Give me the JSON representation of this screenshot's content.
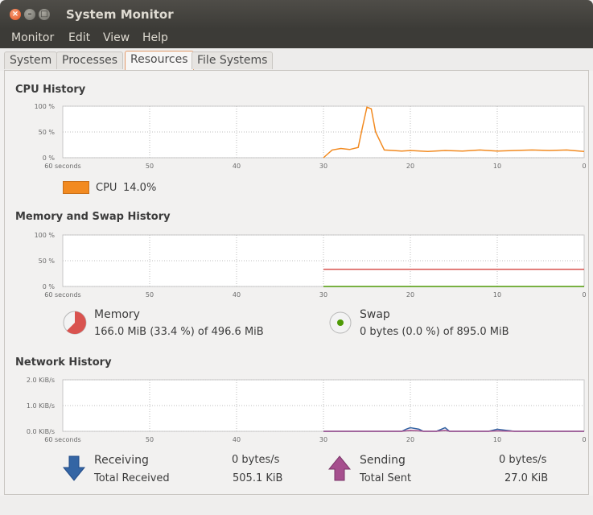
{
  "window": {
    "title": "System Monitor",
    "buttons": {
      "close": "×",
      "minimize": "–",
      "maximize": "□"
    }
  },
  "menu": [
    "Monitor",
    "Edit",
    "View",
    "Help"
  ],
  "tabs": [
    "System",
    "Processes",
    "Resources",
    "File Systems"
  ],
  "active_tab": "Resources",
  "colors": {
    "cpu": "#f28a20",
    "memory": "#d9534f",
    "swap": "#4e9a06",
    "receiving": "#3465a4",
    "sending": "#a64f8e"
  },
  "x_tick_labels": [
    "60 seconds",
    "50",
    "40",
    "30",
    "20",
    "10",
    "0"
  ],
  "cpu": {
    "section_title": "CPU History",
    "y_tick_labels": [
      "100 %",
      "50 %",
      "0 %"
    ],
    "legend_label": "CPU",
    "legend_value": "14.0%"
  },
  "memory_swap": {
    "section_title": "Memory and Swap History",
    "y_tick_labels": [
      "100 %",
      "50 %",
      "0 %"
    ],
    "memory_label": "Memory",
    "memory_value": "166.0 MiB (33.4 %) of 496.6 MiB",
    "swap_label": "Swap",
    "swap_value": "0 bytes (0.0 %) of 895.0 MiB"
  },
  "network": {
    "section_title": "Network History",
    "y_tick_labels": [
      "2.0 KiB/s",
      "1.0 KiB/s",
      "0.0 KiB/s"
    ],
    "receiving_label": "Receiving",
    "receiving_value": "0 bytes/s",
    "total_received_label": "Total Received",
    "total_received_value": "505.1 KiB",
    "sending_label": "Sending",
    "sending_value": "0 bytes/s",
    "total_sent_label": "Total Sent",
    "total_sent_value": "27.0 KiB"
  },
  "chart_data": [
    {
      "type": "line",
      "title": "CPU History",
      "x": [
        30,
        29,
        28,
        27,
        26,
        25.5,
        25,
        24.5,
        24,
        23,
        22,
        21,
        20,
        18,
        16,
        14,
        12,
        10,
        8,
        6,
        4,
        2,
        0
      ],
      "xlim": [
        60,
        0
      ],
      "ylim": [
        0,
        100
      ],
      "series": [
        {
          "name": "CPU",
          "values": [
            0,
            15,
            18,
            16,
            20,
            60,
            98,
            95,
            50,
            15,
            14,
            13,
            14,
            12,
            14,
            13,
            15,
            13,
            14,
            15,
            14,
            15,
            12
          ]
        }
      ]
    },
    {
      "type": "line",
      "title": "Memory and Swap History",
      "x": [
        30,
        0
      ],
      "xlim": [
        60,
        0
      ],
      "ylim": [
        0,
        100
      ],
      "series": [
        {
          "name": "Memory",
          "values": [
            33.4,
            33.4
          ]
        },
        {
          "name": "Swap",
          "values": [
            0,
            0
          ]
        }
      ]
    },
    {
      "type": "line",
      "title": "Network History",
      "x": [
        30,
        21,
        20.5,
        20,
        19,
        18.5,
        17,
        16,
        15.5,
        14,
        11,
        10,
        9,
        8,
        0
      ],
      "xlim": [
        60,
        0
      ],
      "ylim": [
        0,
        2
      ],
      "series": [
        {
          "name": "Receiving",
          "values": [
            0,
            0,
            0.08,
            0.14,
            0.08,
            0,
            0,
            0.14,
            0,
            0,
            0,
            0.08,
            0.04,
            0,
            0
          ]
        },
        {
          "name": "Sending",
          "values": [
            0,
            0,
            0.02,
            0.04,
            0.02,
            0,
            0,
            0.04,
            0,
            0,
            0,
            0.02,
            0.01,
            0,
            0
          ]
        }
      ]
    }
  ]
}
